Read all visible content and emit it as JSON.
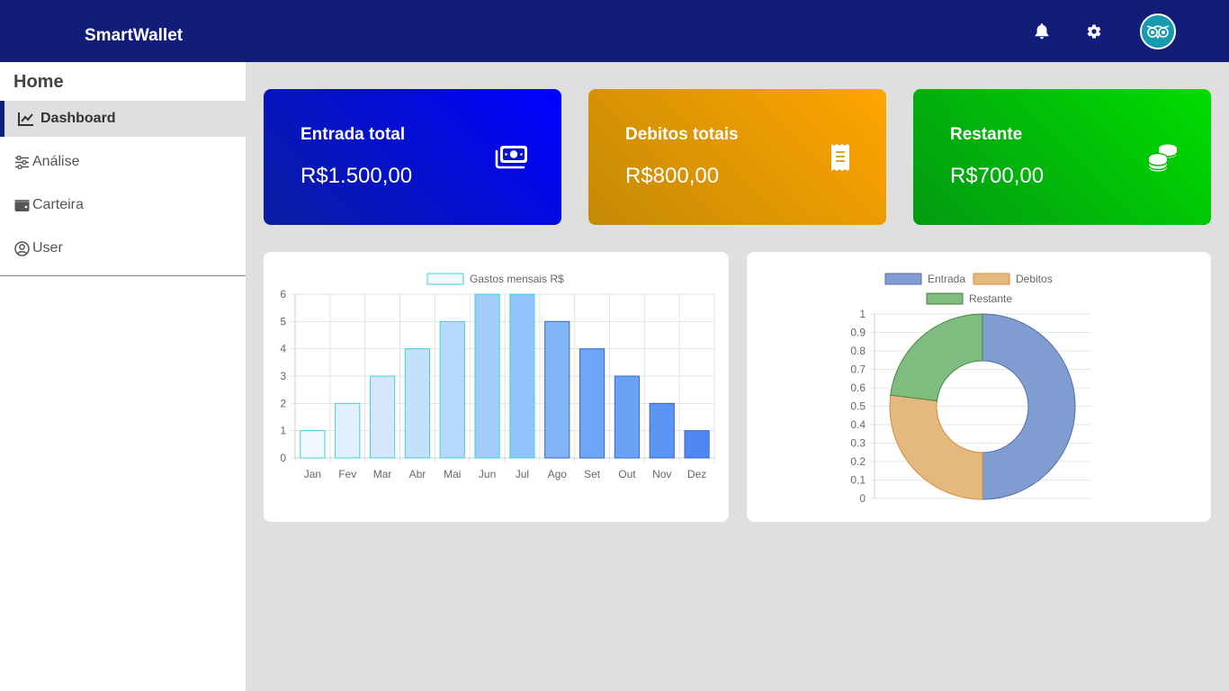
{
  "header": {
    "brand": "SmartWallet",
    "icons": [
      "bell-icon",
      "gear-icon",
      "owl-avatar-icon"
    ]
  },
  "sidebar": {
    "title": "Home",
    "items": [
      {
        "label": "Dashboard",
        "icon": "chart-line-icon",
        "active": true
      },
      {
        "label": "Análise",
        "icon": "sliders-icon",
        "active": false
      },
      {
        "label": "Carteira",
        "icon": "wallet-icon",
        "active": false
      },
      {
        "label": "User",
        "icon": "user-circle-icon",
        "active": false
      }
    ]
  },
  "cards": [
    {
      "title": "Entrada total",
      "value": "R$1.500,00",
      "icon": "money-bill-icon",
      "color": "#0000ff"
    },
    {
      "title": "Debitos totais",
      "value": "R$800,00",
      "icon": "receipt-icon",
      "color": "#ffa500"
    },
    {
      "title": "Restante",
      "value": "R$700,00",
      "icon": "coins-icon",
      "color": "#00cc00"
    }
  ],
  "chart_data": [
    {
      "type": "bar",
      "categories": [
        "Jan",
        "Fev",
        "Mar",
        "Abr",
        "Mai",
        "Jun",
        "Jul",
        "Ago",
        "Set",
        "Out",
        "Nov",
        "Dez"
      ],
      "series": [
        {
          "name": "Gastos mensais R$",
          "values": [
            1,
            2,
            3,
            4,
            5,
            6,
            6,
            5,
            4,
            3,
            2,
            1
          ]
        }
      ],
      "ylim": [
        0,
        6
      ],
      "yticks": [
        0,
        1,
        2,
        3,
        4,
        5,
        6
      ],
      "grid": true,
      "legend": "top-center",
      "colors": [
        "#f2f8ff",
        "#e4efff",
        "#d6e6fc",
        "#c4e1fa",
        "#b6d8fb",
        "#a4ccfb",
        "#92c3fa",
        "#80b6f7",
        "#6fa5f5",
        "#6aa2f5",
        "#5b95f3",
        "#4f88f2"
      ]
    },
    {
      "type": "pie",
      "labels": [
        "Entrada",
        "Debitos",
        "Restante"
      ],
      "values": [
        0.5,
        0.27,
        0.23
      ],
      "colors": [
        "#7f9dd0",
        "#e4b97f",
        "#80bb7f"
      ],
      "ylim": [
        0,
        1
      ],
      "yticks": [
        "0",
        "0.1",
        "0.2",
        "0.3",
        "0.4",
        "0.5",
        "0.6",
        "0.7",
        "0.8",
        "0.9",
        "1"
      ],
      "legend": "top-center"
    }
  ]
}
